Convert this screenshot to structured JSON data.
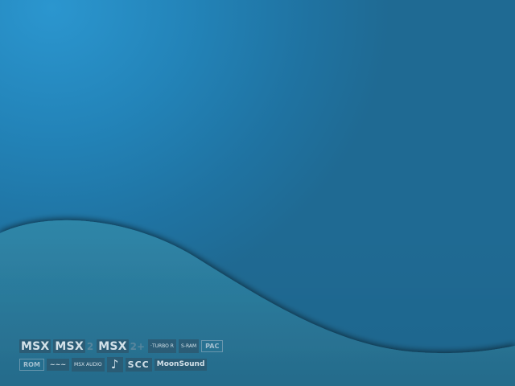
{
  "wallpaper": {
    "colors": {
      "sky_light": "#2b96cf",
      "sky_dark": "#1f6a93",
      "wave_fill": "#2d7c9d",
      "logo_bg": "#2c5f79",
      "logo_text": "#d9e8f0"
    }
  },
  "logos": {
    "row1": {
      "msx": "MSX",
      "msx2": "MSX",
      "msx2_gen": "2",
      "msx2plus": "MSX",
      "msx2plus_gen": "2+",
      "turbo_r": "·TURBO R",
      "sram": "S-RAM",
      "pac": "PAC"
    },
    "row2": {
      "rom": "ROM",
      "music_module": "~~~",
      "msx_audio": "MSX AUDIO",
      "music_note": "♪",
      "scc": "SCC",
      "moonsound": "MoonSound"
    }
  }
}
